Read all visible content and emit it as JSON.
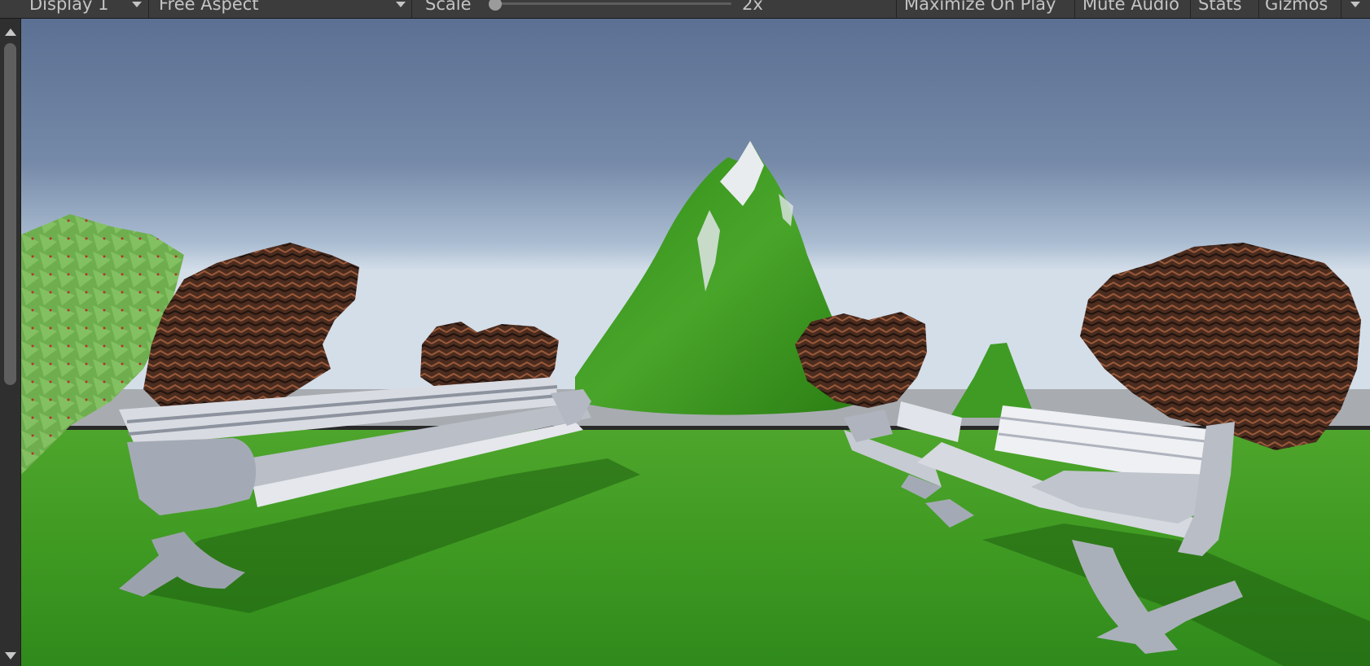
{
  "toolbar": {
    "display_label": "Display 1",
    "aspect_label": "Free Aspect",
    "scale_label": "Scale",
    "scale_value": "2x",
    "scale_slider_fraction": 0.0,
    "maximize_label": "Maximize On Play",
    "mute_label": "Mute Audio",
    "stats_label": "Stats",
    "gizmos_label": "Gizmos"
  },
  "scrollbar": {
    "up_icon": "arrow-up-icon",
    "down_icon": "arrow-down-icon"
  },
  "colors": {
    "toolbar_bg": "#3c3c3c",
    "sky_top": "#5c7296",
    "sky_horizon": "#c9d7e6",
    "grass": "#3f9a24",
    "bench": "#c9ccd3"
  }
}
